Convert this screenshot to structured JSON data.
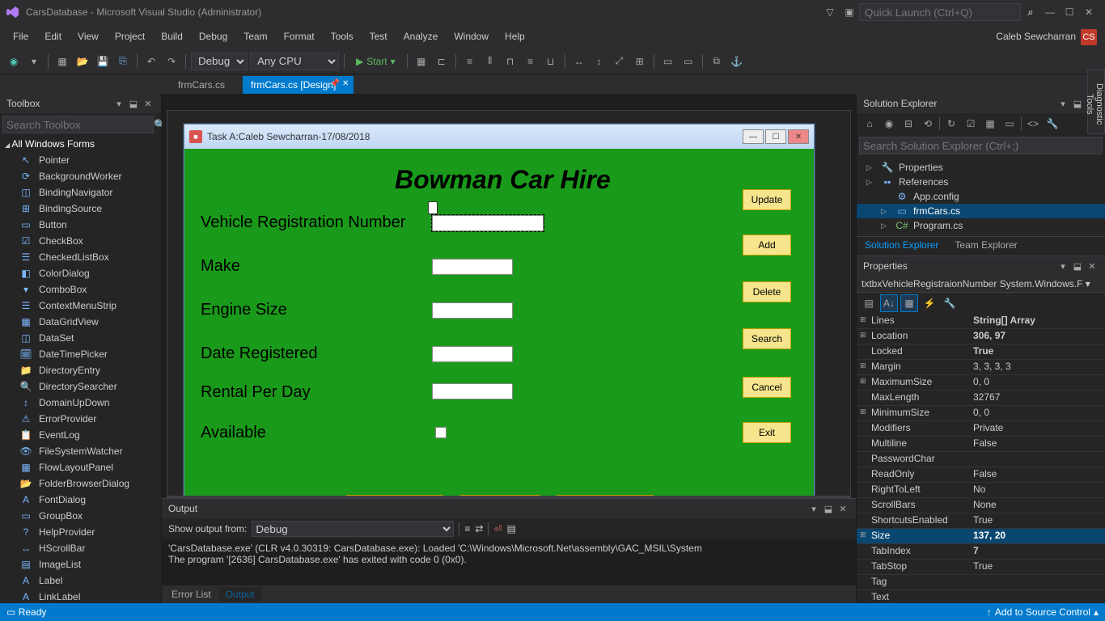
{
  "titlebar": {
    "title": "CarsDatabase - Microsoft Visual Studio  (Administrator)",
    "quick_launch_placeholder": "Quick Launch (Ctrl+Q)",
    "user": "Caleb Sewcharran",
    "badge": "CS"
  },
  "menu": [
    "File",
    "Edit",
    "View",
    "Project",
    "Build",
    "Debug",
    "Team",
    "Format",
    "Tools",
    "Test",
    "Analyze",
    "Window",
    "Help"
  ],
  "toolbar": {
    "config": "Debug",
    "platform": "Any CPU",
    "start": "Start"
  },
  "tabs": [
    {
      "label": "frmCars.cs",
      "active": false
    },
    {
      "label": "frmCars.cs [Design]",
      "active": true
    }
  ],
  "toolbox": {
    "title": "Toolbox",
    "search_placeholder": "Search Toolbox",
    "group": "All Windows Forms",
    "items": [
      "Pointer",
      "BackgroundWorker",
      "BindingNavigator",
      "BindingSource",
      "Button",
      "CheckBox",
      "CheckedListBox",
      "ColorDialog",
      "ComboBox",
      "ContextMenuStrip",
      "DataGridView",
      "DataSet",
      "DateTimePicker",
      "DirectoryEntry",
      "DirectorySearcher",
      "DomainUpDown",
      "ErrorProvider",
      "EventLog",
      "FileSystemWatcher",
      "FlowLayoutPanel",
      "FolderBrowserDialog",
      "FontDialog",
      "GroupBox",
      "HelpProvider",
      "HScrollBar",
      "ImageList",
      "Label",
      "LinkLabel"
    ]
  },
  "form": {
    "window_title": "Task A:Caleb Sewcharran-17/08/2018",
    "heading": "Bowman Car Hire",
    "labels": {
      "reg": "Vehicle Registration Number",
      "make": "Make",
      "engine": "Engine Size",
      "date": "Date Registered",
      "rental": "Rental Per Day",
      "available": "Available"
    },
    "buttons": {
      "update": "Update",
      "add": "Add",
      "delete": "Delete",
      "search": "Search",
      "cancel": "Cancel",
      "exit": "Exit"
    }
  },
  "output": {
    "title": "Output",
    "show_from": "Show output from:",
    "source": "Debug",
    "line1": "'CarsDatabase.exe' (CLR v4.0.30319: CarsDatabase.exe): Loaded 'C:\\Windows\\Microsoft.Net\\assembly\\GAC_MSIL\\System",
    "line2": "The program '[2636] CarsDatabase.exe' has exited with code 0 (0x0).",
    "tabs": {
      "errorlist": "Error List",
      "output": "Output"
    }
  },
  "solution": {
    "title": "Solution Explorer",
    "search_placeholder": "Search Solution Explorer (Ctrl+;)",
    "nodes": {
      "properties": "Properties",
      "references": "References",
      "appconfig": "App.config",
      "frmcars": "frmCars.cs",
      "program": "Program.cs"
    },
    "tabs": {
      "sol": "Solution Explorer",
      "team": "Team Explorer"
    }
  },
  "properties": {
    "title": "Properties",
    "object": "txtbxVehicleRegistraionNumber  System.Windows.F",
    "rows": [
      {
        "name": "Lines",
        "value": "String[] Array",
        "exp": "+",
        "bold": true
      },
      {
        "name": "Location",
        "value": "306, 97",
        "exp": "+",
        "bold": true
      },
      {
        "name": "Locked",
        "value": "True",
        "bold": true
      },
      {
        "name": "Margin",
        "value": "3, 3, 3, 3",
        "exp": "+"
      },
      {
        "name": "MaximumSize",
        "value": "0, 0",
        "exp": "+"
      },
      {
        "name": "MaxLength",
        "value": "32767"
      },
      {
        "name": "MinimumSize",
        "value": "0, 0",
        "exp": "+"
      },
      {
        "name": "Modifiers",
        "value": "Private"
      },
      {
        "name": "Multiline",
        "value": "False"
      },
      {
        "name": "PasswordChar",
        "value": ""
      },
      {
        "name": "ReadOnly",
        "value": "False"
      },
      {
        "name": "RightToLeft",
        "value": "No"
      },
      {
        "name": "ScrollBars",
        "value": "None"
      },
      {
        "name": "ShortcutsEnabled",
        "value": "True"
      },
      {
        "name": "Size",
        "value": "137, 20",
        "exp": "+",
        "sel": true,
        "bold": true
      },
      {
        "name": "TabIndex",
        "value": "7",
        "bold": true
      },
      {
        "name": "TabStop",
        "value": "True"
      },
      {
        "name": "Tag",
        "value": ""
      },
      {
        "name": "Text",
        "value": ""
      }
    ]
  },
  "diag": "Diagnostic Tools",
  "status": {
    "ready": "Ready",
    "source_control": "Add to Source Control"
  }
}
